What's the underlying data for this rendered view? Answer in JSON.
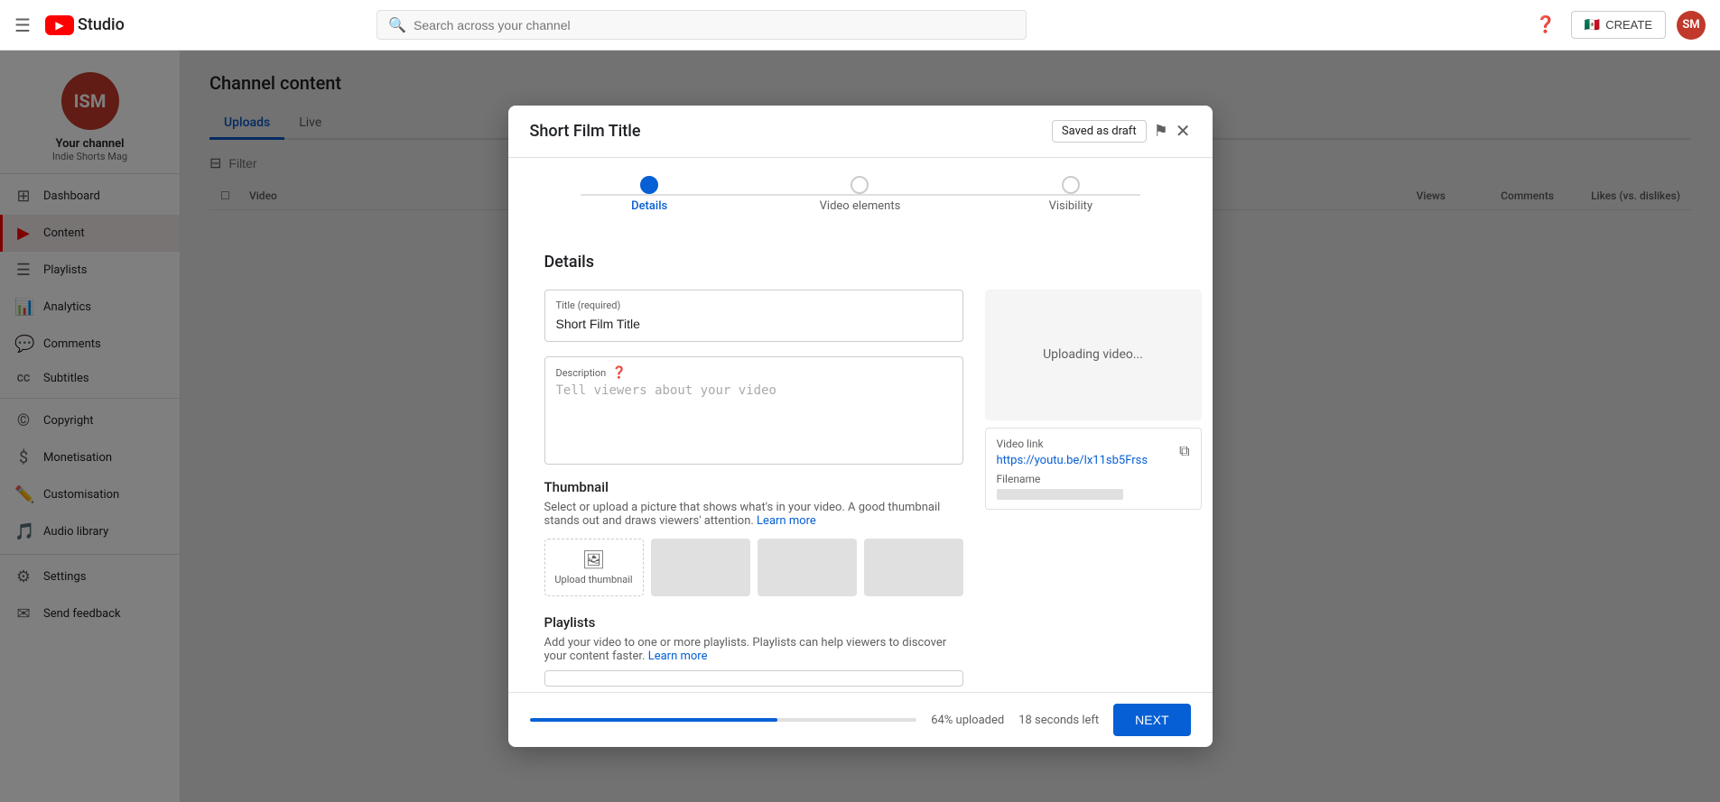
{
  "header": {
    "hamburger_label": "☰",
    "logo_text": "Studio",
    "search_placeholder": "Search across your channel",
    "help_icon": "?",
    "create_label": "CREATE",
    "create_flag": "🇲🇽",
    "avatar_initials": "SM"
  },
  "sidebar": {
    "channel_name": "Your channel",
    "channel_sub": "Indie Shorts Mag",
    "channel_initials": "ISM",
    "items": [
      {
        "id": "dashboard",
        "label": "Dashboard",
        "icon": "⊞"
      },
      {
        "id": "content",
        "label": "Content",
        "icon": "▶",
        "active": true
      },
      {
        "id": "playlists",
        "label": "Playlists",
        "icon": "☰"
      },
      {
        "id": "analytics",
        "label": "Analytics",
        "icon": "📊"
      },
      {
        "id": "comments",
        "label": "Comments",
        "icon": "💬"
      },
      {
        "id": "subtitles",
        "label": "Subtitles",
        "icon": "CC"
      },
      {
        "id": "copyright",
        "label": "Copyright",
        "icon": "©"
      },
      {
        "id": "monetisation",
        "label": "Monetisation",
        "icon": "$"
      },
      {
        "id": "customisation",
        "label": "Customisation",
        "icon": "✏️"
      },
      {
        "id": "audio-library",
        "label": "Audio library",
        "icon": "🎵"
      },
      {
        "id": "settings",
        "label": "Settings",
        "icon": "⚙"
      },
      {
        "id": "send-feedback",
        "label": "Send feedback",
        "icon": "✉"
      }
    ]
  },
  "main": {
    "title": "Channel content",
    "tabs": [
      {
        "id": "uploads",
        "label": "Uploads",
        "active": true
      },
      {
        "id": "live",
        "label": "Live"
      }
    ],
    "filter_placeholder": "Filter",
    "table_headers": {
      "video": "Video",
      "views": "Views",
      "comments": "Comments",
      "likes": "Likes (vs. dislikes)"
    }
  },
  "modal": {
    "title": "Short Film Title",
    "saved_badge": "Saved as draft",
    "steps": [
      {
        "id": "details",
        "label": "Details",
        "active": true
      },
      {
        "id": "video-elements",
        "label": "Video elements"
      },
      {
        "id": "visibility",
        "label": "Visibility"
      }
    ],
    "section_title": "Details",
    "title_field_label": "Title (required)",
    "title_field_value": "Short Film Title",
    "description_field_label": "Description",
    "description_placeholder": "Tell viewers about your video",
    "video_preview_text": "Uploading video...",
    "video_link_label": "Video link",
    "video_link_url": "https://youtu.be/lx11sb5Frss",
    "filename_label": "Filename",
    "thumbnail_title": "Thumbnail",
    "thumbnail_desc": "Select or upload a picture that shows what's in your video. A good thumbnail stands out and draws viewers' attention.",
    "thumbnail_learn_more": "Learn more",
    "thumbnail_upload_label": "Upload thumbnail",
    "playlists_title": "Playlists",
    "playlists_desc": "Add your video to one or more playlists. Playlists can help viewers to discover your content faster.",
    "playlists_learn_more": "Learn more",
    "playlists_dropdown_placeholder": "",
    "progress_percent": 64,
    "progress_label": "64% uploaded",
    "time_left": "18 seconds left",
    "next_button_label": "NEXT"
  }
}
